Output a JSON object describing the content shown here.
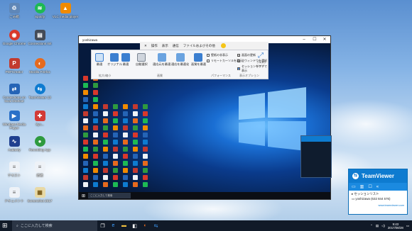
{
  "desktop_icons": [
    {
      "label": "ごみ箱",
      "icon": "recycle-bin-icon",
      "color": "#5f87b8"
    },
    {
      "label": "Spotify",
      "icon": "spotify-icon",
      "color": "#1db954"
    },
    {
      "label": "VLC media player",
      "icon": "vlc-icon",
      "color": "#f08a00"
    },
    {
      "label": "Google Chrome",
      "icon": "chrome-icon",
      "color": "#d8382b"
    },
    {
      "label": "Connections Init",
      "icon": "connect-icon",
      "color": "#444b57"
    },
    {
      "label": "PDFCreator",
      "icon": "pdf-icon",
      "color": "#c23a2f"
    },
    {
      "label": "Mozilla Firefox",
      "icon": "firefox-icon",
      "color": "#e66a1e"
    },
    {
      "label": "Connections on local shortcut",
      "icon": "network-icon",
      "color": "#2564b6"
    },
    {
      "label": "TeamViewer 13",
      "icon": "teamviewer-icon",
      "color": "#0e7bd0"
    },
    {
      "label": "Windows Media Player",
      "icon": "media-player-icon",
      "color": "#2a70c8"
    },
    {
      "label": "Syn...",
      "icon": "app-icon",
      "color": "#d23a37"
    },
    {
      "label": "Audacity",
      "icon": "audacity-icon",
      "color": "#1f3f8f"
    },
    {
      "label": "Recording App",
      "icon": "recorder-icon",
      "color": "#2e9a3f"
    },
    {
      "label": "テキスト",
      "icon": "text-file-icon",
      "color": "#eef2f7"
    },
    {
      "label": "新規",
      "icon": "new-file-icon",
      "color": "#eef2f7"
    },
    {
      "label": "ドキュメント",
      "icon": "document-icon",
      "color": "#eef2f7"
    },
    {
      "label": "Screenshot 2017",
      "icon": "image-file-icon",
      "color": "#e8d9a5"
    }
  ],
  "remote_window": {
    "title": "yoshizawa",
    "min": "–",
    "max": "☐",
    "close": "✕"
  },
  "tv_toolbar": {
    "items": [
      "✕",
      "操作",
      "表示",
      "通信",
      "ファイルおよびその他"
    ]
  },
  "ribbon": {
    "buttons": [
      "最適",
      "オリジナル",
      "最適",
      "自動選択",
      "適応元を最適",
      "適応を最適化",
      "画質を最適"
    ],
    "groups": [
      "拡大/縮小",
      "画質",
      "パフォーマンス",
      "表示オプション"
    ],
    "checks": [
      "壁紙の非表示",
      "リモートカーソルを表示",
      "画面の更新",
      "全ウィンドウを選択",
      "セッションをタブで表示"
    ],
    "fullscreen": "フルスクリーン"
  },
  "remote_taskbar": {
    "search": "ここに入力して検索"
  },
  "teamviewer_panel": {
    "title": "TeamViewer",
    "sessions_label": "セッションリスト",
    "session_entry": "yoshizawa (632 844 576)",
    "link": "www.teamviewer.com"
  },
  "taskbar": {
    "search_placeholder": "ここに入力して検索",
    "time": "9:43",
    "date": "2017/08/28"
  },
  "colors": {
    "teamviewer_blue": "#0e7bd0",
    "taskbar": "#111a28"
  }
}
